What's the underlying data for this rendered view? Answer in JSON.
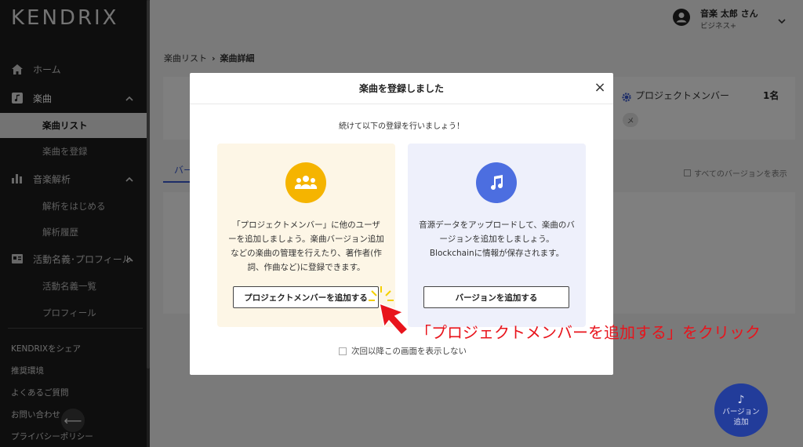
{
  "sidebar": {
    "logo": "KENDRIX",
    "items": [
      {
        "label": "ホーム"
      },
      {
        "label": "楽曲"
      },
      {
        "label": "楽曲リスト"
      },
      {
        "label": "楽曲を登録"
      },
      {
        "label": "音楽解析"
      },
      {
        "label": "解析をはじめる"
      },
      {
        "label": "解析履歴"
      },
      {
        "label": "活動名義･プロフィール"
      },
      {
        "label": "活動名義一覧"
      },
      {
        "label": "プロフィール"
      }
    ],
    "footer": [
      "KENDRIXをシェア",
      "推奨環境",
      "よくあるご質問",
      "お問い合わせ",
      "プライバシーポリシー"
    ]
  },
  "header": {
    "user_name": "音楽 太郎 さん",
    "user_plan": "ビジネス+"
  },
  "breadcrumb": {
    "parent": "楽曲リスト",
    "current": "楽曲詳細"
  },
  "background": {
    "member_label": "プロジェクトメンバー",
    "member_count": "1名",
    "chip": "メ",
    "tab_fragment": "バー",
    "all_versions": "すべてのバージョンを表示"
  },
  "fab": {
    "line1": "バージョン",
    "line2": "追加"
  },
  "modal": {
    "title": "楽曲を登録しました",
    "close": "×",
    "subtitle": "続けて以下の登録を行いましょう！",
    "left_card": {
      "icon": "group-icon",
      "text": "「プロジェクトメンバー」に他のユーザーを追加しましょう。楽曲バージョン追加などの楽曲の管理を行えたり、著作者(作詞、作曲など)に登録できます。",
      "button": "プロジェクトメンバーを追加する"
    },
    "right_card": {
      "icon": "music-note-icon",
      "text": "音源データをアップロードして、楽曲のバージョンを追加をしましょう。Blockchainに情報が保存されます。",
      "button": "バージョンを追加する"
    },
    "dont_show": "次回以降この画面を表示しない"
  },
  "annotation": {
    "text": "「プロジェクトメンバーを追加する」をクリック",
    "color": "#e8141c"
  }
}
